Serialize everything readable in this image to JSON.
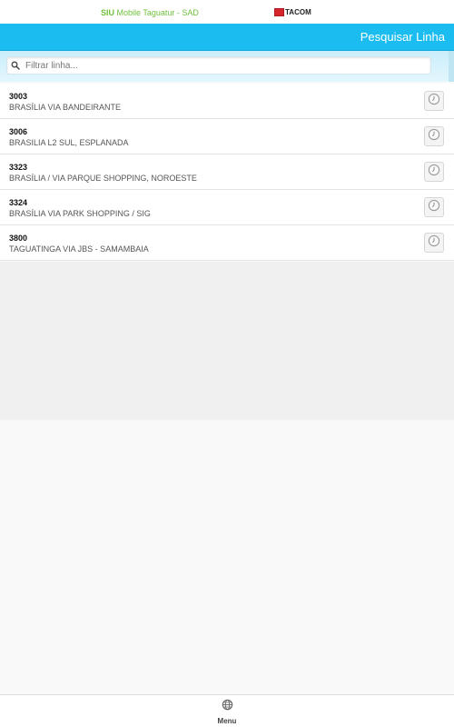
{
  "topbar": {
    "app_prefix": "SIU",
    "app_name": " Mobile Taguatur - SAD",
    "logo_text": "TACOM"
  },
  "header": {
    "title": "Pesquisar Linha"
  },
  "filter": {
    "placeholder": "Filtrar linha...",
    "value": ""
  },
  "lines": [
    {
      "code": "3003",
      "name": "BRASÍLIA VIA BANDEIRANTE"
    },
    {
      "code": "3006",
      "name": "BRASILIA L2 SUL, ESPLANADA"
    },
    {
      "code": "3323",
      "name": "BRASÍLIA / VIA PARQUE SHOPPING, NOROESTE"
    },
    {
      "code": "3324",
      "name": "BRASÍLIA VIA PARK SHOPPING / SIG"
    },
    {
      "code": "3800",
      "name": "TAGUATINGA VIA JBS - SAMAMBAIA"
    }
  ],
  "footer": {
    "menu_label": "Menu"
  },
  "colors": {
    "header": "#1bbcef",
    "app_text": "#6fbf3a",
    "logo_mark": "#d7262b"
  }
}
